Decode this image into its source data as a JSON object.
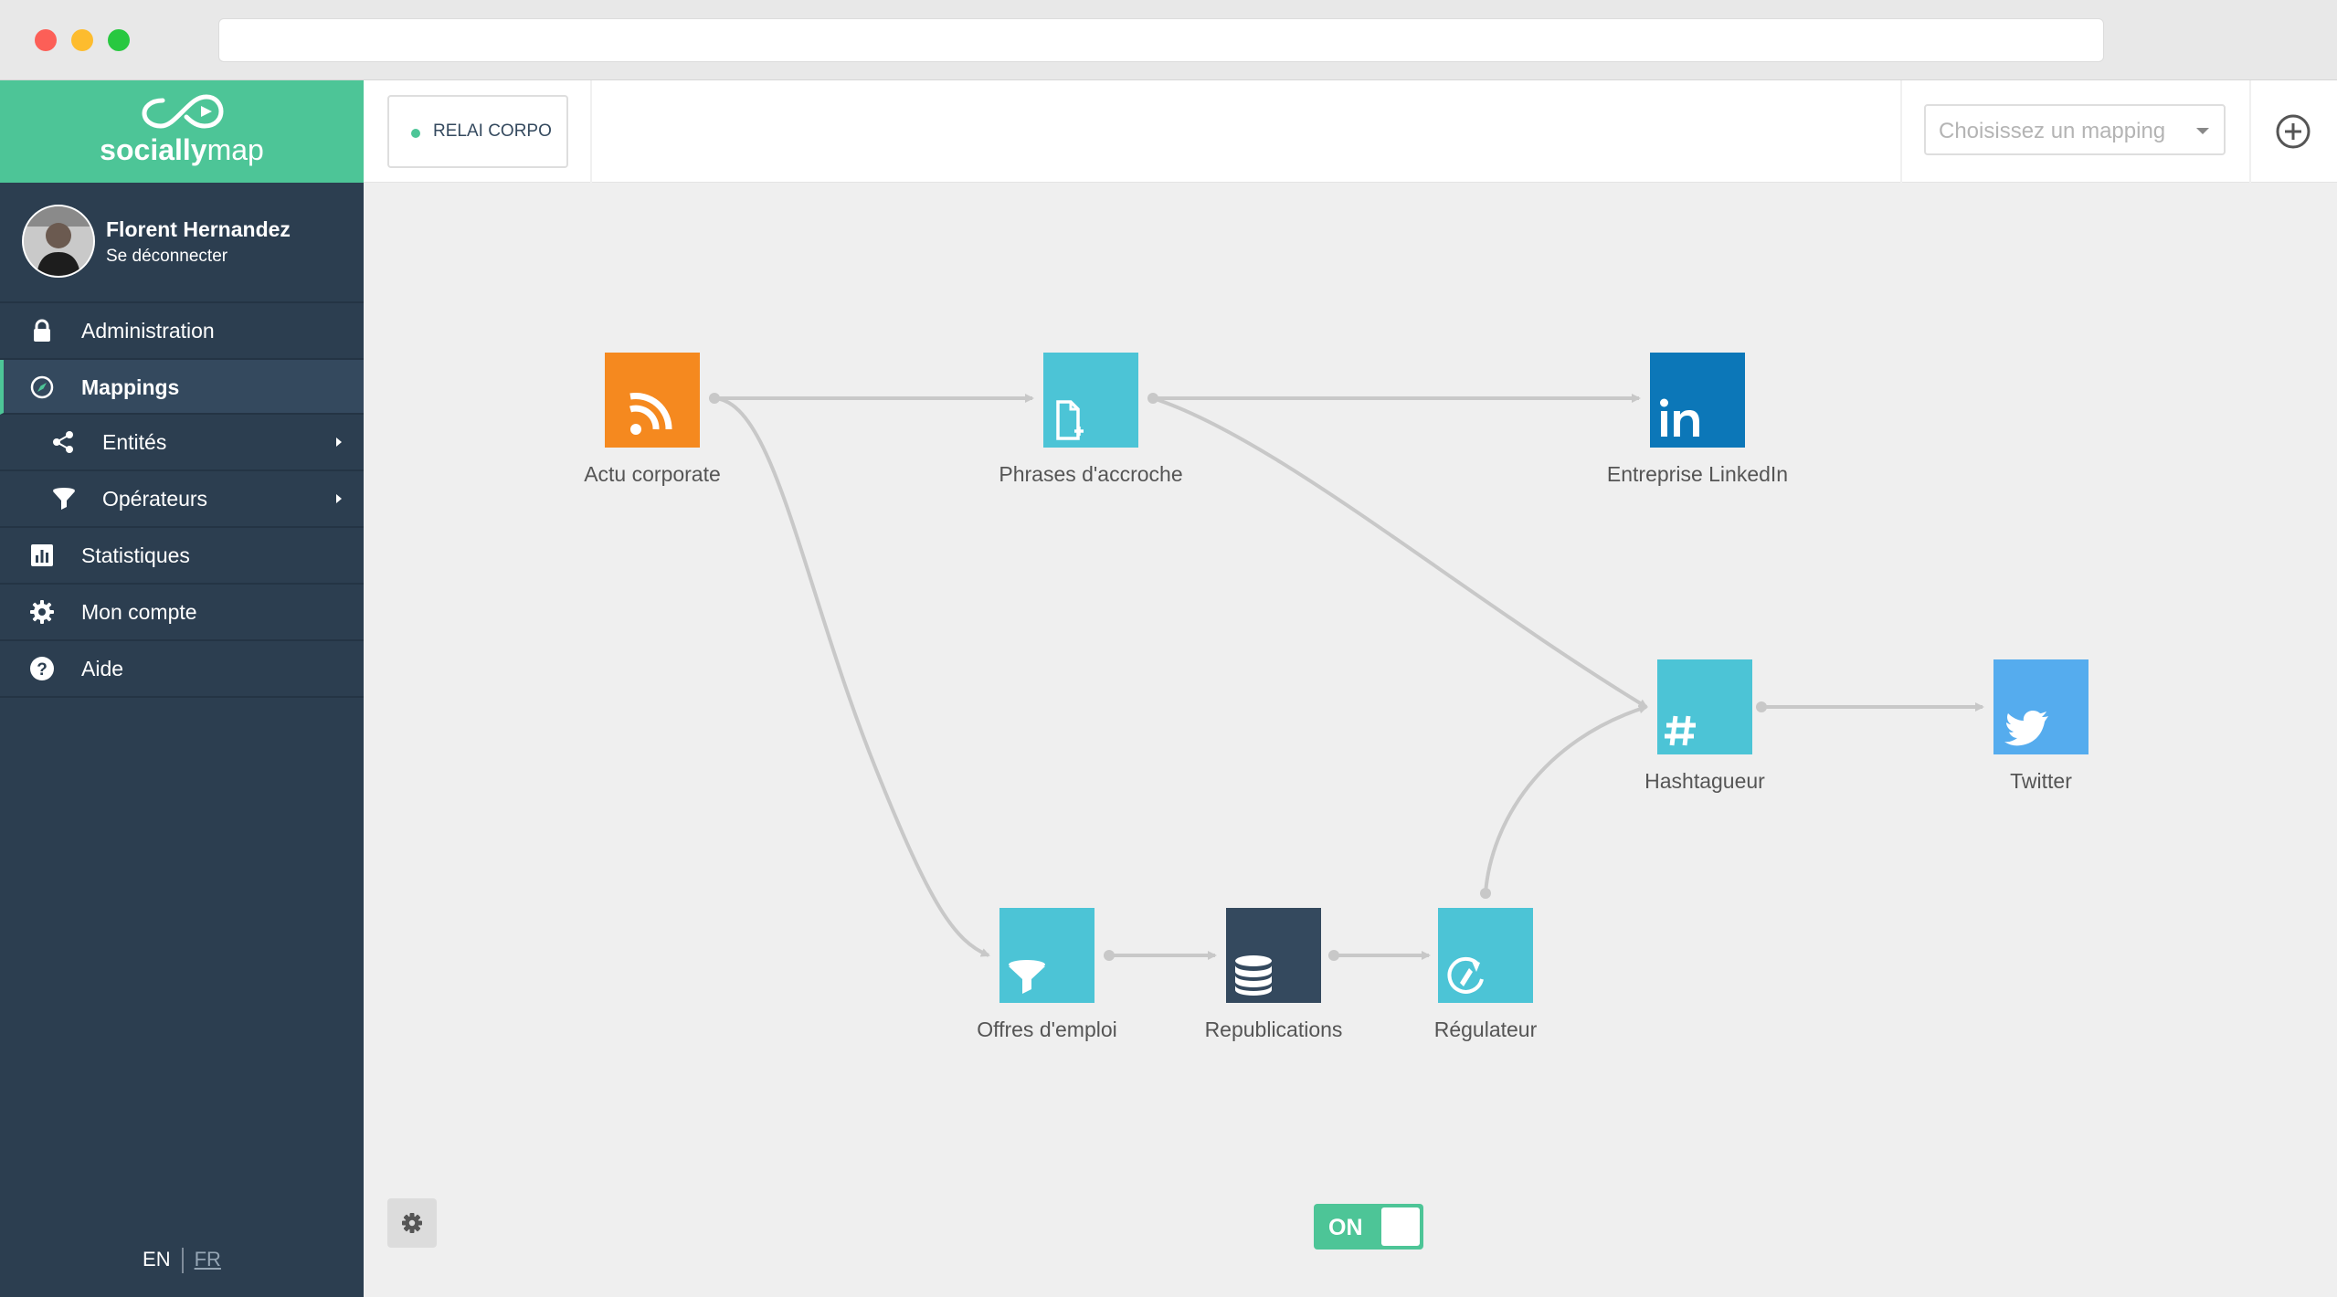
{
  "brand": {
    "name_bold": "socially",
    "name_light": "map",
    "color": "#4dc597"
  },
  "user": {
    "name": "Florent Hernandez",
    "logout": "Se déconnecter"
  },
  "nav": {
    "administration": "Administration",
    "mappings": "Mappings",
    "entites": "Entités",
    "operateurs": "Opérateurs",
    "statistiques": "Statistiques",
    "mon_compte": "Mon compte",
    "aide": "Aide"
  },
  "lang": {
    "en": "EN",
    "fr": "FR"
  },
  "topbar": {
    "mapping_tab": "RELAI CORPO",
    "mapping_select_placeholder": "Choisissez un mapping"
  },
  "nodes": {
    "actu": {
      "label": "Actu corporate",
      "color": "#f5891f",
      "icon": "rss-icon"
    },
    "phrases": {
      "label": "Phrases d'accroche",
      "color": "#4cc4d6",
      "icon": "file-plus-icon"
    },
    "linkedin": {
      "label": "Entreprise LinkedIn",
      "color": "#0c77b8",
      "icon": "linkedin-icon"
    },
    "hashtag": {
      "label": "Hashtagueur",
      "color": "#4cc4d6",
      "icon": "hashtag-icon"
    },
    "twitter": {
      "label": "Twitter",
      "color": "#55acee",
      "icon": "twitter-icon"
    },
    "offres": {
      "label": "Offres d'emploi",
      "color": "#4cc4d6",
      "icon": "filter-icon"
    },
    "repub": {
      "label": "Republications",
      "color": "#34495e",
      "icon": "database-icon"
    },
    "regul": {
      "label": "Régulateur",
      "color": "#4cc4d6",
      "icon": "refresh-icon"
    }
  },
  "toggle": {
    "label": "ON",
    "state": "on"
  }
}
